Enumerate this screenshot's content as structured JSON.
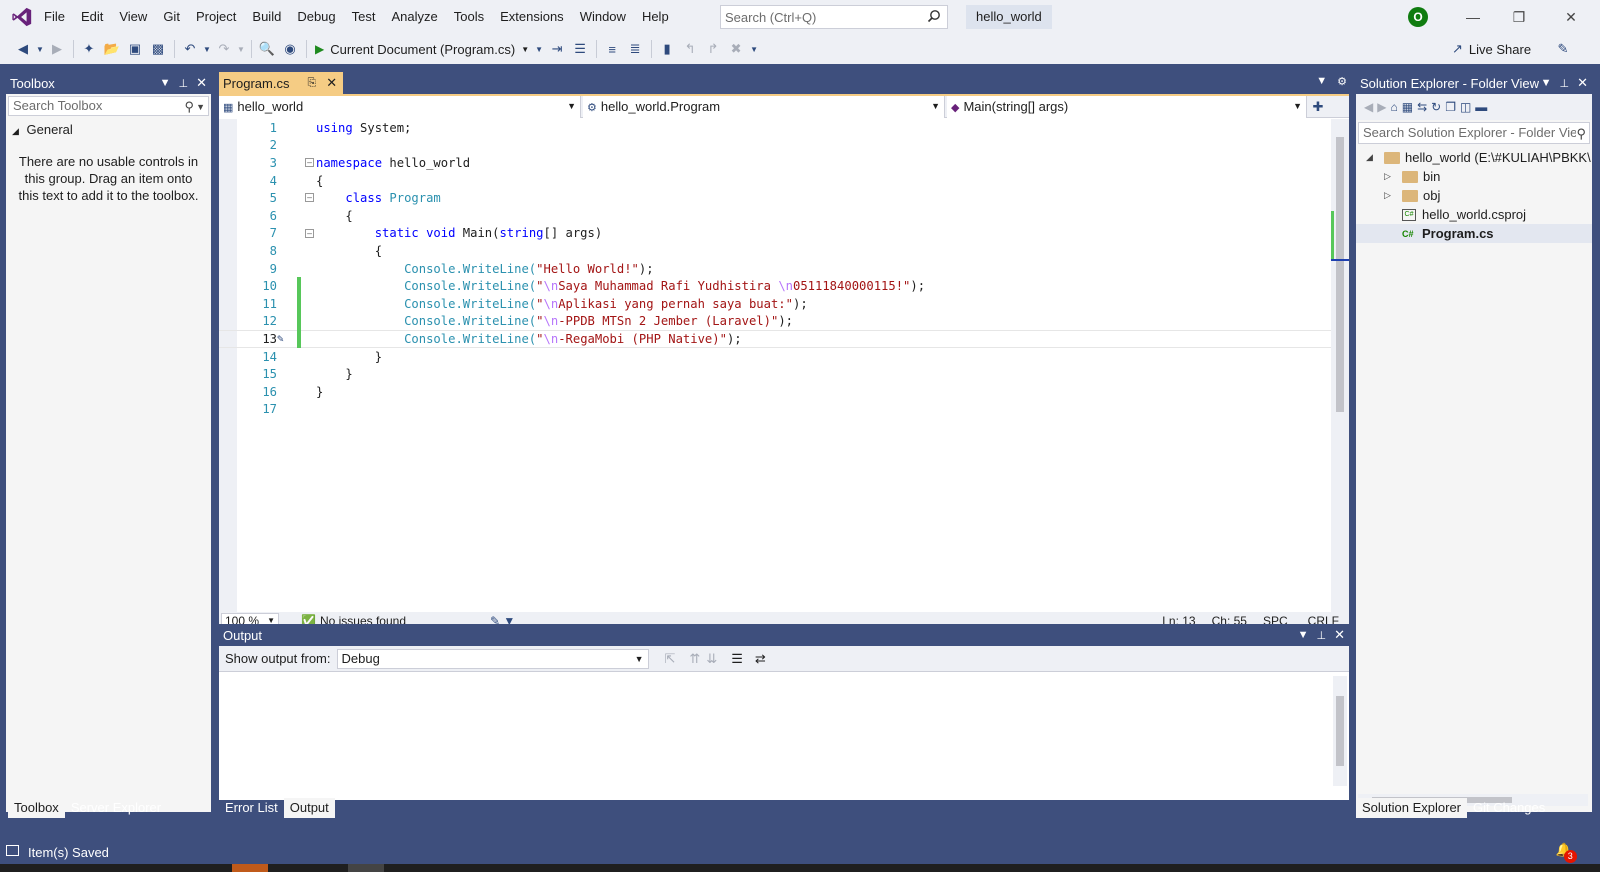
{
  "menu": [
    "File",
    "Edit",
    "View",
    "Git",
    "Project",
    "Build",
    "Debug",
    "Test",
    "Analyze",
    "Tools",
    "Extensions",
    "Window",
    "Help"
  ],
  "search": {
    "placeholder": "Search (Ctrl+Q)"
  },
  "solution_name": "hello_world",
  "account_initial": "O",
  "toolbar": {
    "run_label": "Current Document (Program.cs)",
    "live_share": "Live Share"
  },
  "toolbox": {
    "title": "Toolbox",
    "search_placeholder": "Search Toolbox",
    "group": "General",
    "empty_text": "There are no usable controls in this group. Drag an item onto this text to add it to the toolbox.",
    "tabs": [
      "Toolbox",
      "Server Explorer"
    ]
  },
  "editor": {
    "tab_label": "Program.cs",
    "nav": {
      "project": "hello_world",
      "type": "hello_world.Program",
      "member": "Main(string[] args)"
    },
    "current_line": 13,
    "lines": [
      "1",
      "2",
      "3",
      "4",
      "5",
      "6",
      "7",
      "8",
      "9",
      "10",
      "11",
      "12",
      "13",
      "14",
      "15",
      "16",
      "17"
    ],
    "code": {
      "l1_kw": "using",
      "l1_rest": " System;",
      "l3_kw": "namespace",
      "l3_rest": " hello_world",
      "brace_open": "{",
      "brace_close": "}",
      "l5_kw": "class",
      "l5_type": "Program",
      "l7_kw1": "static",
      "l7_kw2": "void",
      "l7_name": " Main(",
      "l7_kw3": "string",
      "l7_rest": "[] args)",
      "console": "Console",
      "writeline": ".WriteLine(",
      "close": ");",
      "s9": "\"Hello World!\"",
      "s10a": "\"",
      "s10_esc1": "\\n",
      "s10b": "Saya Muhammad Rafi Yudhistira ",
      "s10_esc2": "\\n",
      "s10c": "05111840000115!\"",
      "s11a": "\"",
      "s11_esc": "\\n",
      "s11b": "Aplikasi yang pernah saya buat:\"",
      "s12a": "\"",
      "s12_esc": "\\n",
      "s12b": "-PPDB MTSn 2 Jember (Laravel)\"",
      "s13a": "\"",
      "s13_esc": "\\n",
      "s13b": "-RegaMobi (PHP Native)\""
    },
    "zoom": "100 %",
    "issues": "No issues found",
    "ln": "Ln: 13",
    "ch": "Ch: 55",
    "spc": "SPC",
    "crlf": "CRLF"
  },
  "output": {
    "title": "Output",
    "show_from_label": "Show output from:",
    "source": "Debug",
    "tabs": [
      "Error List",
      "Output"
    ]
  },
  "solution_explorer": {
    "title": "Solution Explorer - Folder View",
    "search_placeholder": "Search Solution Explorer - Folder Vie",
    "root": "hello_world (E:\\#KULIAH\\PBKK\\",
    "items": [
      "bin",
      "obj",
      "hello_world.csproj",
      "Program.cs"
    ],
    "tabs": [
      "Solution Explorer",
      "Git Changes"
    ]
  },
  "status": {
    "text": "Item(s) Saved",
    "notifications": "3"
  },
  "colors": {
    "accent": "#68217a",
    "frame": "#3e4f7d",
    "tab_active": "#f5cc84",
    "change_bar": "#57c75a"
  }
}
